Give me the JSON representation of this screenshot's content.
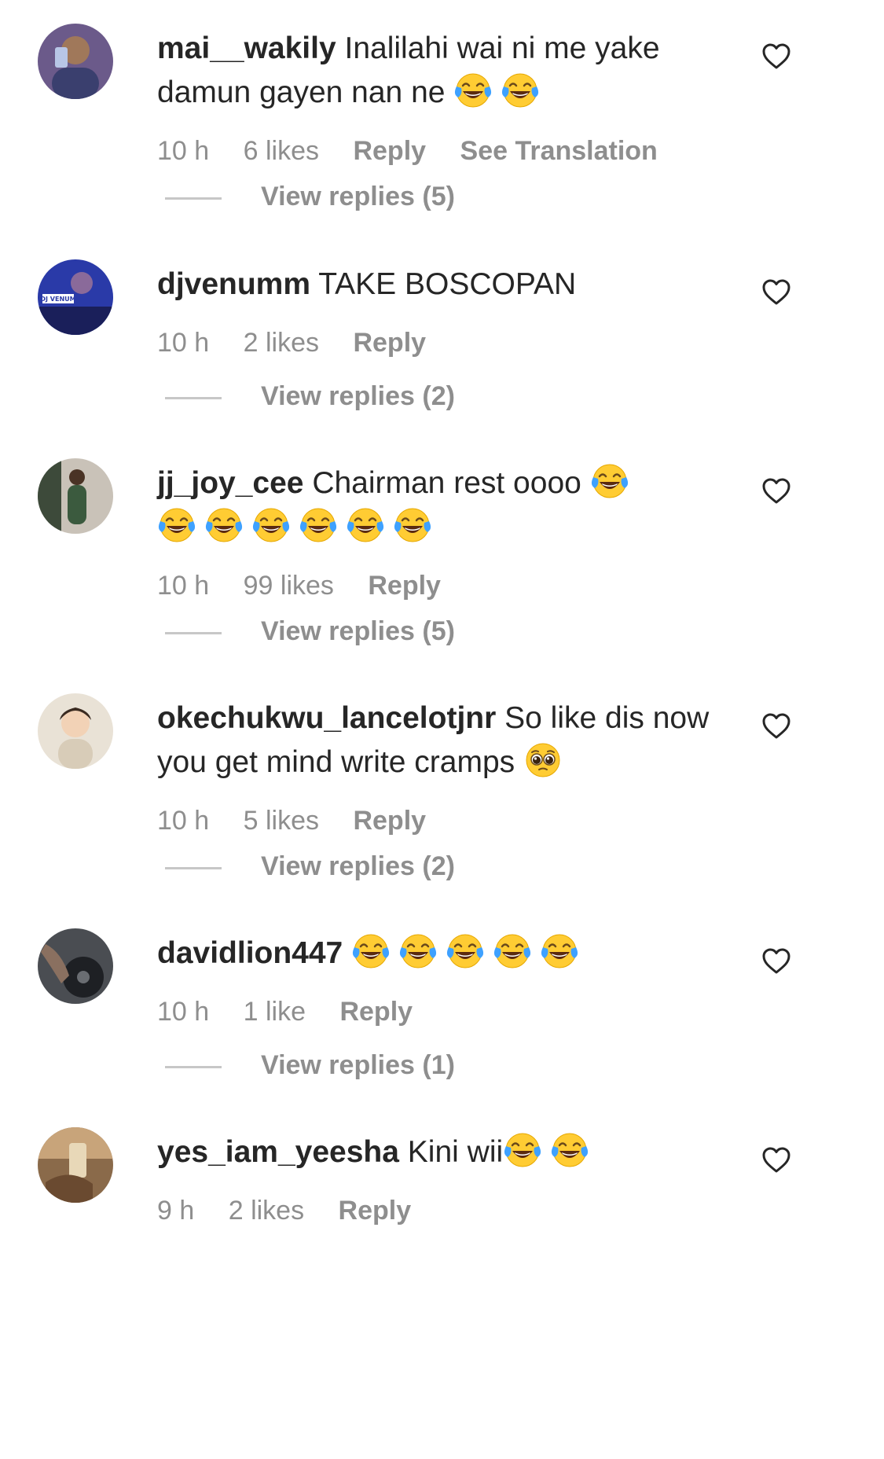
{
  "comments": [
    {
      "username": "mai__wakily",
      "text": "Inalilahi wai ni me yake damun gayen nan ne",
      "emojis": [
        "face-with-tears-of-joy",
        "face-with-tears-of-joy"
      ],
      "time": "10 h",
      "likes": "6 likes",
      "reply": "Reply",
      "translation": "See Translation",
      "view_replies": "View replies (5)",
      "avatar_color": "#6b5a8a"
    },
    {
      "username": "djvenumm",
      "text": "TAKE BOSCOPAN",
      "emojis": [],
      "time": "10 h",
      "likes": "2 likes",
      "reply": "Reply",
      "view_replies": "View replies (2)",
      "avatar_color": "#2a3aa8",
      "avatar_badge": "DJ VENUM"
    },
    {
      "username": "jj_joy_cee",
      "text": "Chairman rest oooo",
      "emojis": [
        "face-with-tears-of-joy",
        "face-with-tears-of-joy",
        "face-with-tears-of-joy",
        "face-with-tears-of-joy",
        "face-with-tears-of-joy",
        "face-with-tears-of-joy",
        "face-with-tears-of-joy"
      ],
      "time": "10 h",
      "likes": "99 likes",
      "reply": "Reply",
      "view_replies": "View replies (5)",
      "avatar_color": "#3d4a3a"
    },
    {
      "username": "okechukwu_lancelotjnr",
      "text": "So like dis now you get mind write cramps",
      "emojis": [
        "pleading-face"
      ],
      "time": "10 h",
      "likes": "5 likes",
      "reply": "Reply",
      "view_replies": "View replies (2)",
      "avatar_color": "#e9e2d6"
    },
    {
      "username": "davidlion447",
      "text": "",
      "emojis": [
        "face-with-tears-of-joy",
        "face-with-tears-of-joy",
        "face-with-tears-of-joy",
        "face-with-tears-of-joy",
        "face-with-tears-of-joy"
      ],
      "time": "10 h",
      "likes": "1 like",
      "reply": "Reply",
      "view_replies": "View replies (1)",
      "avatar_color": "#4a4d52"
    },
    {
      "username": "yes_iam_yeesha",
      "text": "Kini wii",
      "emojis": [
        "face-with-tears-of-joy",
        "face-with-tears-of-joy"
      ],
      "time": "9 h",
      "likes": "2 likes",
      "reply": "Reply",
      "avatar_color": "#8a6a4a"
    }
  ],
  "colors": {
    "text": "#262626",
    "secondary": "#8e8e8e",
    "divider": "#c7c7c7",
    "emoji_face": "#ffcc33",
    "emoji_tear": "#3ea1ff"
  },
  "icons": {
    "like": "heart-outline-icon"
  }
}
